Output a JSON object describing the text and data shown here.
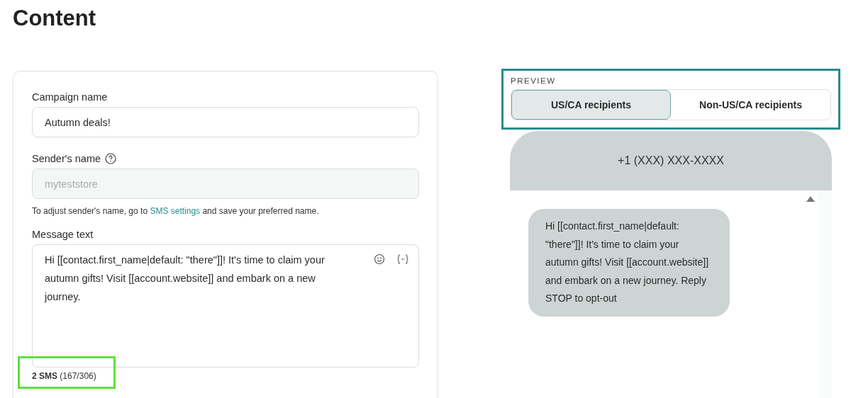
{
  "title": "Content",
  "form": {
    "campaign_label": "Campaign name",
    "campaign_value": "Autumn deals!",
    "sender_label": "Sender's name",
    "sender_value": "myteststore",
    "sender_disabled": true,
    "sender_hint_before": "To adjust sender's name, go to ",
    "sender_hint_link": "SMS settings",
    "sender_hint_after": " and save your preferred name.",
    "message_label": "Message text",
    "message_value": "Hi [[contact.first_name|default: \"there\"]]! It's time to claim your autumn gifts! Visit [[account.website]] and embark on a new journey.",
    "sms_count": "**2 SMS** (167/306)"
  },
  "preview": {
    "label": "PREVIEW",
    "tabs": [
      {
        "label": "US/CA recipients",
        "selected": true
      },
      {
        "label": "Non-US/CA recipients",
        "selected": false
      }
    ],
    "phone_number": "+1 (XXX) XXX-XXXX",
    "message": "Hi [[contact.first_name|default: \"there\"]]! It's time to claim your autumn gifts! Visit [[account.website]] and embark on a new journey. Reply STOP to opt-out"
  }
}
